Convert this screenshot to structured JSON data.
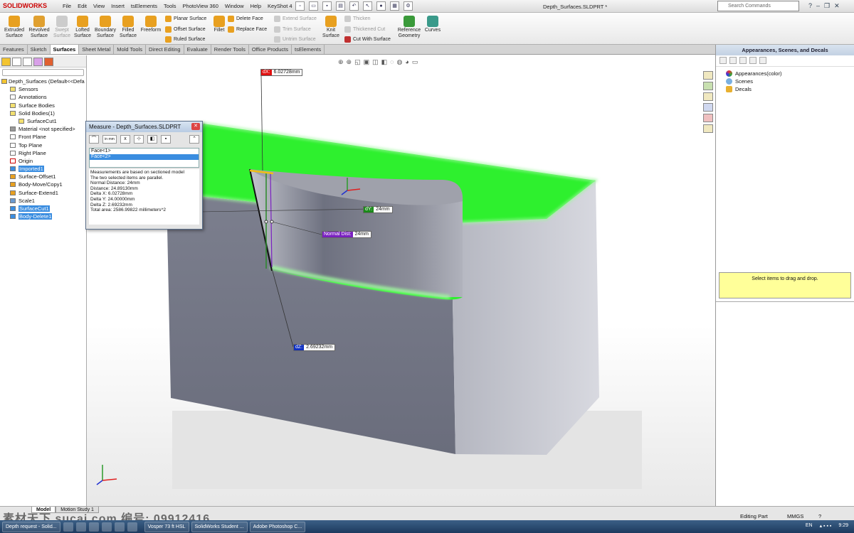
{
  "app": {
    "logo": "SOLIDWORKS",
    "menu": [
      "File",
      "Edit",
      "View",
      "Insert",
      "tsElements",
      "Tools",
      "PhotoView 360",
      "Window",
      "Help",
      "KeyShot 4"
    ],
    "document_title": "Depth_Surfaces.SLDPRT *",
    "search_placeholder": "Search Commands"
  },
  "ribbon": {
    "big_buttons": [
      {
        "label1": "Extruded",
        "label2": "Surface"
      },
      {
        "label1": "Revolved",
        "label2": "Surface"
      },
      {
        "label1": "Swept",
        "label2": "Surface"
      },
      {
        "label1": "Lofted",
        "label2": "Surface"
      },
      {
        "label1": "Boundary",
        "label2": "Surface"
      },
      {
        "label1": "Filled",
        "label2": "Surface"
      },
      {
        "label1": "Freeform",
        "label2": ""
      }
    ],
    "small_col1": [
      "Planar Surface",
      "Offset Surface",
      "Ruled Surface"
    ],
    "fillet": "Fillet",
    "small_col2": [
      "Delete Face",
      "Replace Face"
    ],
    "small_col3": [
      "Extend Surface",
      "Trim Surface",
      "Untrim Surface"
    ],
    "knit": {
      "label1": "Knit",
      "label2": "Surface"
    },
    "small_col4": [
      "Thicken",
      "Thickened Cut",
      "Cut With Surface"
    ],
    "reference": {
      "label1": "Reference",
      "label2": "Geometry"
    },
    "curves": "Curves"
  },
  "tabs": [
    "Features",
    "Sketch",
    "Surfaces",
    "Sheet Metal",
    "Mold Tools",
    "Direct Editing",
    "Evaluate",
    "Render Tools",
    "Office Products",
    "tsElements"
  ],
  "active_tab": "Surfaces",
  "feature_tree": {
    "root": "Depth_Surfaces  (Default<<Defa",
    "items": [
      {
        "label": "Sensors",
        "selected": false
      },
      {
        "label": "Annotations",
        "selected": false
      },
      {
        "label": "Surface Bodies",
        "selected": false
      },
      {
        "label": "Solid Bodies(1)",
        "selected": false
      },
      {
        "label": "SurfaceCut1",
        "selected": false
      },
      {
        "label": "Material <not specified>",
        "selected": false
      },
      {
        "label": "Front Plane",
        "selected": false
      },
      {
        "label": "Top Plane",
        "selected": false
      },
      {
        "label": "Right Plane",
        "selected": false
      },
      {
        "label": "Origin",
        "selected": false
      },
      {
        "label": "Imported1",
        "selected": true
      },
      {
        "label": "Surface-Offset1",
        "selected": false
      },
      {
        "label": "Body-Move/Copy1",
        "selected": false
      },
      {
        "label": "Surface-Extend1",
        "selected": false
      },
      {
        "label": "Scale1",
        "selected": false
      },
      {
        "label": "SurfaceCut1",
        "selected": true
      },
      {
        "label": "Body-Delete1",
        "selected": true
      }
    ]
  },
  "measure_dialog": {
    "title": "Measure - Depth_Surfaces.SLDPRT",
    "units_icon": "in mm",
    "selections": [
      "Face<1>",
      "Face<2>"
    ],
    "results": [
      "Measurements are based on sectioned model",
      "The two selected items are parallel.",
      "Normal Distance: 24mm",
      "Distance: 24.89130mm",
      "Delta X: 6.02728mm",
      "Delta Y: 24.00000mm",
      "Delta Z: 2.69232mm",
      "Total area: 2586.99822 millimeters^2"
    ]
  },
  "callouts": {
    "dx": {
      "key": "dX:",
      "value": "6.02728mm",
      "color": "#e01010"
    },
    "dy": {
      "key": "dY:",
      "value": "24mm",
      "color": "#1a8a1a"
    },
    "normal": {
      "key": "Normal Dist:",
      "value": "24mm",
      "color": "#7a20c0"
    },
    "dz": {
      "key": "dZ:",
      "value": "2.69232mm",
      "color": "#1030c0"
    }
  },
  "task_pane": {
    "title": "Appearances, Scenes, and Decals",
    "items": [
      "Appearances(color)",
      "Scenes",
      "Decals"
    ],
    "drop_text": "Select items to drag and drop."
  },
  "status": {
    "bottom_tabs": [
      "Model",
      "Motion Study 1"
    ],
    "mode": "Editing Part",
    "units": "MMGS"
  },
  "watermark": "素材天下 sucai.com  编号: 09912416",
  "taskbar": {
    "items": [
      "Depth request - Solid...",
      "Vosper 73 ft HSL",
      "SolidWorks Student ...",
      "Adobe Photoshop C..."
    ],
    "lang": "EN",
    "time": "9:29"
  },
  "colors": {
    "highlight_green": "#2ef02e",
    "part_gray": "#7a7d8c",
    "selection_blue": "#3a8de0"
  }
}
